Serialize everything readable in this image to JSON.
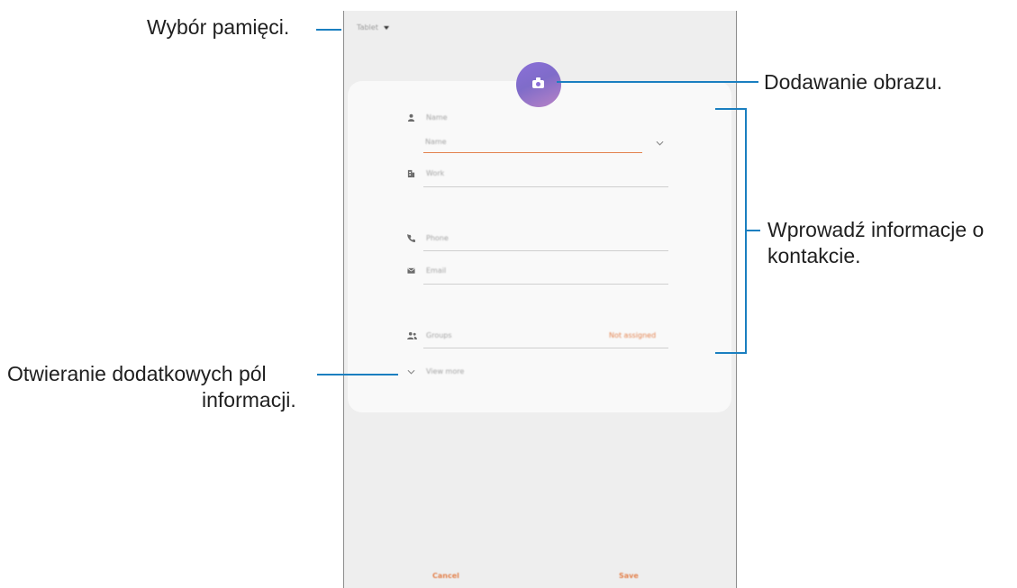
{
  "annotations": {
    "storage": "Wybór pamięci.",
    "add_image": "Dodawanie obrazu.",
    "enter_info_line1": "Wprowadź informacje o",
    "enter_info_line2": "kontakcie.",
    "more_fields_line1": "Otwieranie dodatkowych pól",
    "more_fields_line2": "informacji."
  },
  "screen": {
    "storage_label": "Tablet",
    "fields": {
      "name_header": "Name",
      "name_placeholder": "Name",
      "work_placeholder": "Work",
      "phone_placeholder": "Phone",
      "email_placeholder": "Email",
      "groups_placeholder": "Groups",
      "groups_value": "Not assigned"
    },
    "view_more": "View more",
    "cancel": "Cancel",
    "save": "Save"
  },
  "colors": {
    "accent": "#e3834f",
    "callout": "#1a7fc0"
  }
}
